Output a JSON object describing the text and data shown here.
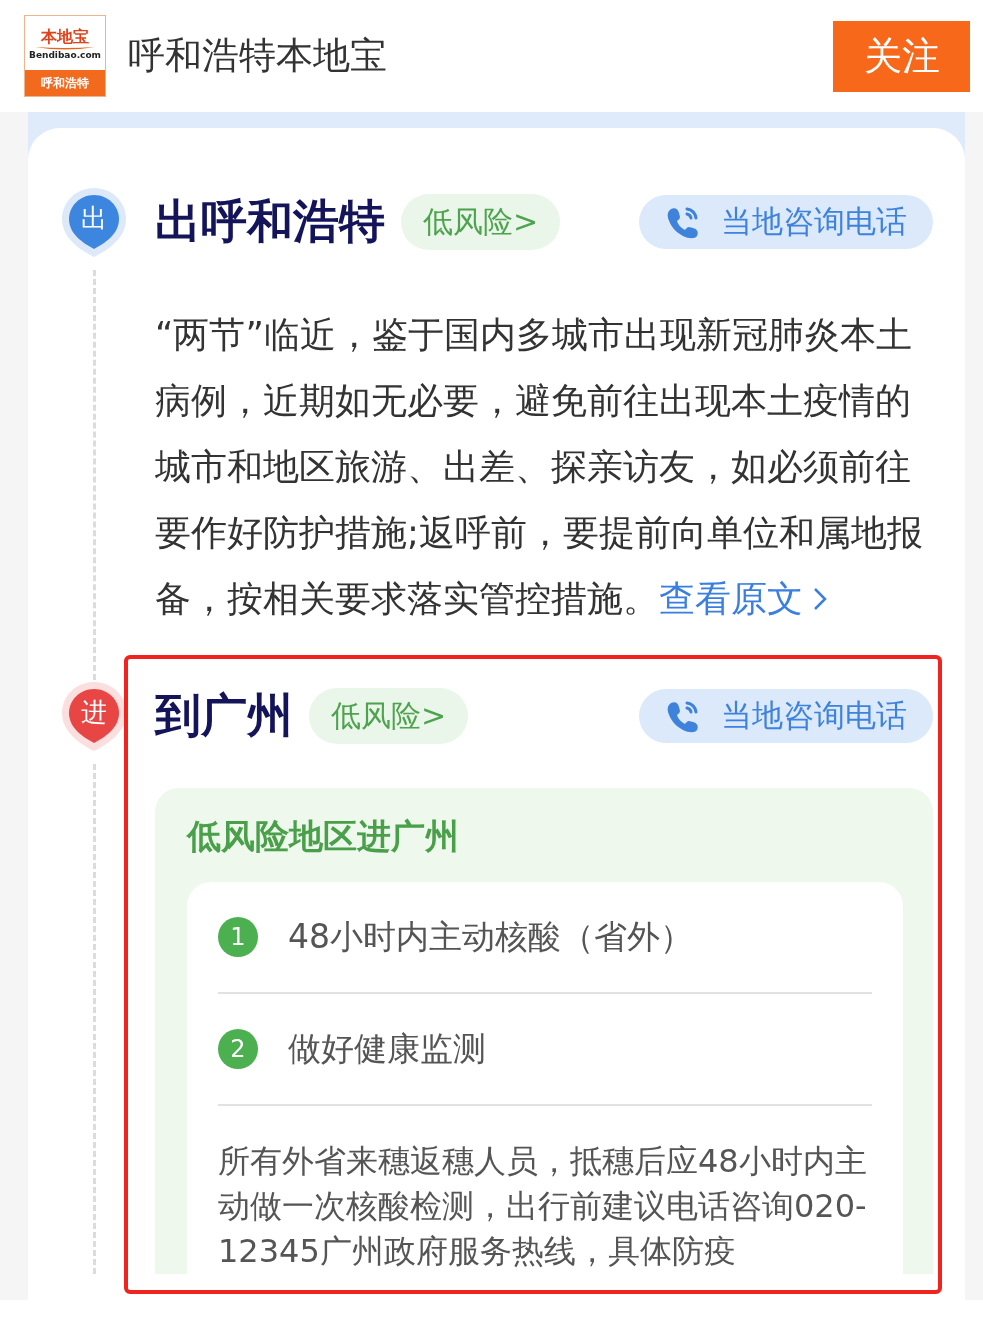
{
  "header": {
    "logo": {
      "top": "本地宝",
      "domain": "Bendibao.com",
      "bottom": "呼和浩特"
    },
    "title": "呼和浩特本地宝",
    "follow_button": "关注"
  },
  "sections": [
    {
      "kind": "departure",
      "marker": "出",
      "title": "出呼和浩特",
      "risk_badge": "低风险>",
      "phone_button": "当地咨询电话",
      "highlighted": false,
      "notice": "“两节”临近，鉴于国内多城市出现新冠肺炎本土病例，近期如无必要，避免前往出现本土疫情的城市和地区旅游、出差、探亲访友，如必须前往要作好防护措施;返呼前，要提前向单位和属地报备，按相关要求落实管控措施。",
      "link": "查看原文"
    },
    {
      "kind": "arrival",
      "marker": "进",
      "title": "到广州",
      "risk_badge": "低风险>",
      "phone_button": "当地咨询电话",
      "highlighted": true,
      "requirements": {
        "title": "低风险地区进广州",
        "items": [
          {
            "number": "1",
            "text": "48小时内主动核酸（省外）"
          },
          {
            "number": "2",
            "text": "做好健康监测"
          }
        ],
        "note": "所有外省来穗返穗人员，抵穗后应48小时内主动做一次核酸检测，出行前建议电话咨询020-12345广州政府服务热线，具体防疫"
      }
    }
  ]
}
